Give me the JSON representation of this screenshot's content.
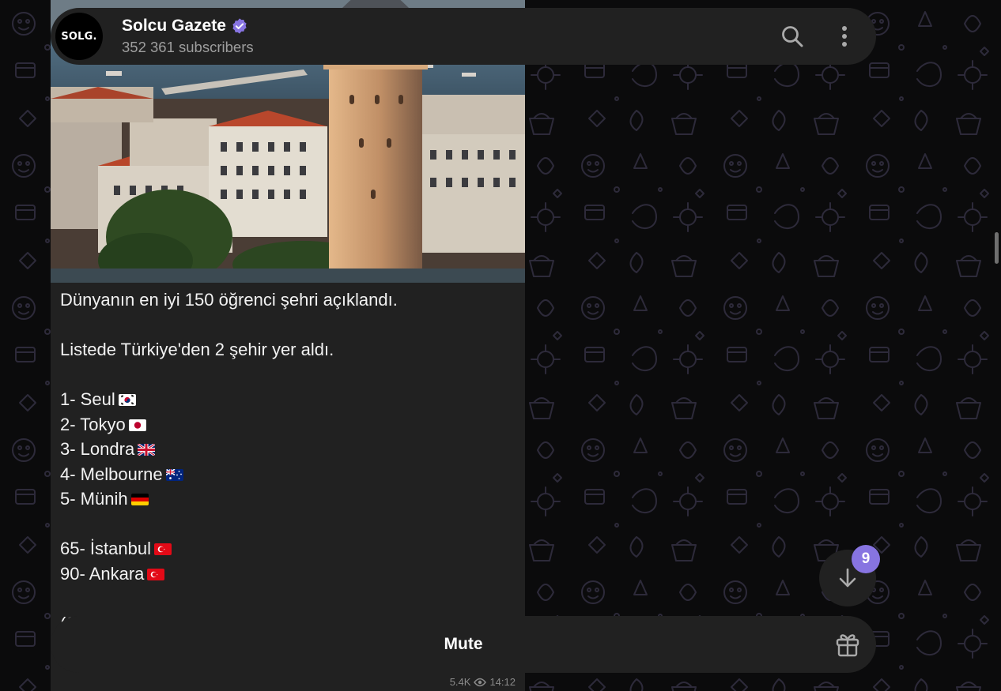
{
  "header": {
    "avatar_text": "SOLG.",
    "title": "Solcu Gazete",
    "subscribers": "352 361 subscribers",
    "icons": [
      "verified-icon",
      "search-icon",
      "more-vert-icon"
    ],
    "verified_color": "#8774e1"
  },
  "message": {
    "headline": "Dünyanın en iyi 150 öğrenci şehri açıklandı.",
    "intro": "Listede Türkiye'den 2 şehir yer aldı.",
    "ranking": [
      {
        "text": "1- Seul",
        "flag": "south-korea-flag"
      },
      {
        "text": "2- Tokyo",
        "flag": "japan-flag"
      },
      {
        "text": "3- Londra",
        "flag": "uk-flag"
      },
      {
        "text": "4- Melbourne",
        "flag": "australia-flag"
      },
      {
        "text": "5- Münih",
        "flag": "germany-flag"
      }
    ],
    "turkey": [
      {
        "text": "65- İstanbul",
        "flag": "turkey-flag"
      },
      {
        "text": "90- Ankara",
        "flag": "turkey-flag"
      }
    ],
    "partial_line": "(Seç ... eli Seç...)",
    "views": "5.4K",
    "time": "14:12"
  },
  "bottom_bar": {
    "mute_label": "Mute",
    "icons": [
      "gift-icon"
    ]
  },
  "scroll_down": {
    "unread_count": "9",
    "icon": "arrow-down-icon",
    "badge_color": "#8774e1"
  }
}
